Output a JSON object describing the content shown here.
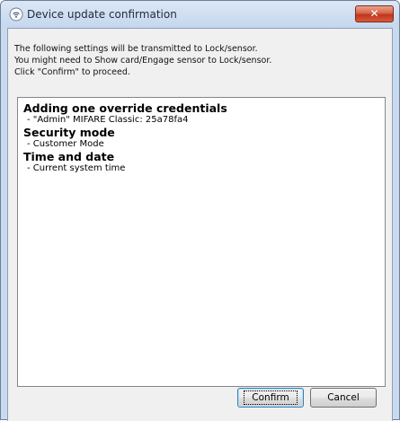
{
  "window": {
    "title": "Device update confirmation",
    "close_label": "✕"
  },
  "intro": {
    "line1": "The following settings will be transmitted to Lock/sensor.",
    "line2": "You might need to Show card/Engage sensor to Lock/sensor.",
    "line3": "Click \"Confirm\" to proceed."
  },
  "details": {
    "sections": [
      {
        "heading": "Adding one override credentials",
        "items": [
          "- \"Admin\" MIFARE Classic: 25a78fa4"
        ]
      },
      {
        "heading": "Security mode",
        "items": [
          "- Customer Mode"
        ]
      },
      {
        "heading": "Time and date",
        "items": [
          "- Current system time"
        ]
      }
    ]
  },
  "buttons": {
    "confirm_label": "Confirm",
    "cancel_label": "Cancel"
  },
  "icons": {
    "title_icon": "wireless-signal-icon",
    "close_icon": "close-icon"
  },
  "colors": {
    "close_button": "#c2351b",
    "frame": "#c9daef",
    "default_button_border": "#3c7fb1"
  }
}
